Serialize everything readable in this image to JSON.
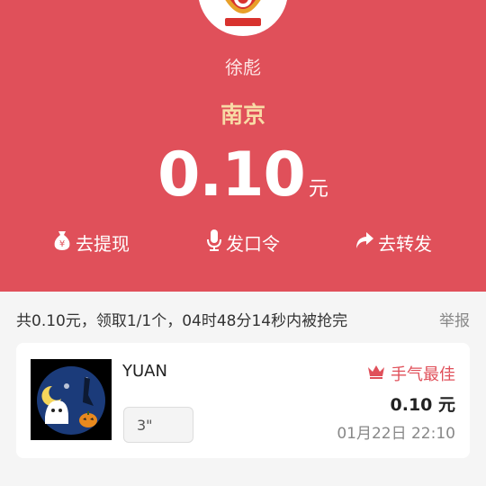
{
  "header": {
    "sender": "徐彪",
    "title": "南京",
    "amount": "0.10",
    "unit": "元"
  },
  "actions": [
    {
      "label": "去提现",
      "icon": "money-bag-icon"
    },
    {
      "label": "发口令",
      "icon": "microphone-icon"
    },
    {
      "label": "去转发",
      "icon": "share-arrow-icon"
    }
  ],
  "summary": {
    "text": "共0.10元，领取1/1个，04时48分14秒内被抢完",
    "report": "举报"
  },
  "record": {
    "name": "YUAN",
    "voice_duration": "3\"",
    "badge": "手气最佳",
    "amount": "0.10 元",
    "time": "01月22日 22:10"
  },
  "colors": {
    "header_bg": "#e0505a",
    "title": "#f8dba6",
    "accent": "#e0505a"
  }
}
